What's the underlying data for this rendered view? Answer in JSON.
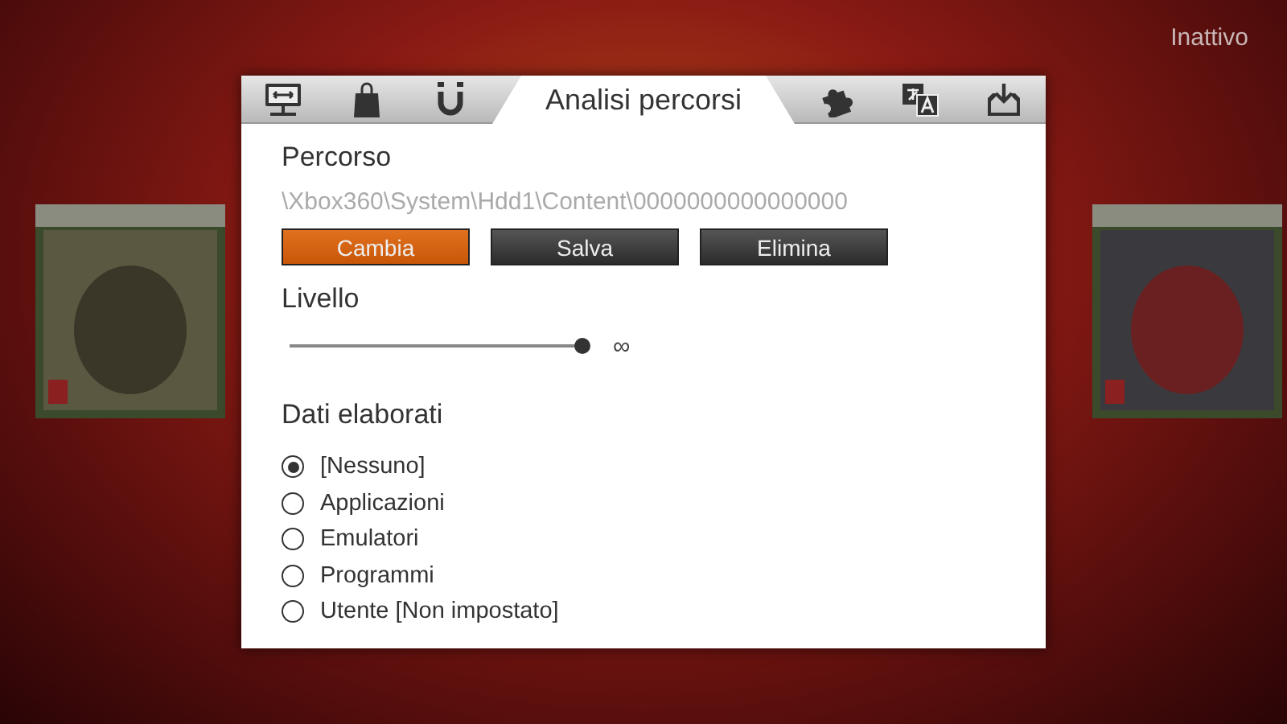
{
  "status": "Inattivo",
  "tabs": [
    {
      "kind": "icon",
      "selected": false
    },
    {
      "kind": "icon",
      "selected": false
    },
    {
      "kind": "icon",
      "selected": false
    },
    {
      "kind": "text",
      "label": "Analisi percorsi",
      "selected": true
    },
    {
      "kind": "icon",
      "selected": false
    },
    {
      "kind": "icon",
      "selected": false
    },
    {
      "kind": "icon",
      "selected": false
    }
  ],
  "path_section": {
    "title": "Percorso",
    "path": "\\Xbox360\\System\\Hdd1\\Content\\0000000000000000",
    "buttons": [
      {
        "label": "Cambia",
        "selected": true
      },
      {
        "label": "Salva",
        "selected": false
      },
      {
        "label": "Elimina",
        "selected": false
      }
    ]
  },
  "level_section": {
    "title": "Livello",
    "level": 1,
    "reading": "∞"
  },
  "data_section": {
    "title": "Dati elaborati",
    "options": [
      {
        "label": "[Nessuno]",
        "selected": true
      },
      {
        "label": "Applicazioni",
        "selected": false
      },
      {
        "label": "Emulatori",
        "selected": false
      },
      {
        "label": "Programmi",
        "selected": false
      },
      {
        "label": "Utente [Non impostato]",
        "selected": false
      }
    ]
  }
}
